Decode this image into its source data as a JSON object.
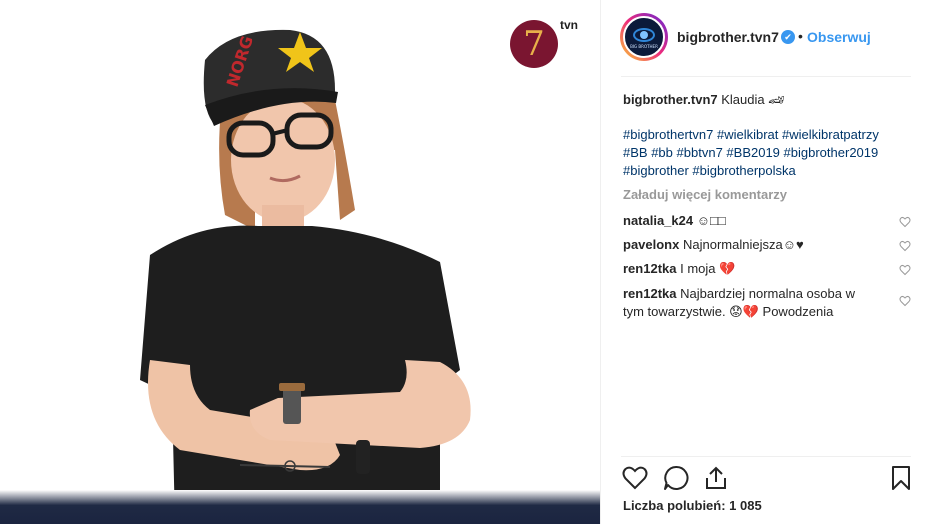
{
  "photo": {
    "channel_number": "7",
    "channel_name": "tvn",
    "cap_text": "NORG"
  },
  "header": {
    "username": "bigbrother.tvn7",
    "verified_mark": "✔",
    "separator": "•",
    "follow_label": "Obserwuj",
    "avatar_text": "BIG BROTHER"
  },
  "caption": {
    "username": "bigbrother.tvn7",
    "text": "Klaudia 🏎",
    "hashtags": [
      "#bigbrothertvn7",
      "#wielkibrat",
      "#wielkibratpatrzy",
      "#BB",
      "#bb",
      "#bbtvn7",
      "#BB2019",
      "#bigbrother2019",
      "#bigbrother",
      "#bigbrotherpolska"
    ]
  },
  "load_more_label": "Załaduj więcej komentarzy",
  "comments": [
    {
      "user": "natalia_k24",
      "text": "☺□□"
    },
    {
      "user": "pavelonx",
      "text": "Najnormalniejsza☺♥"
    },
    {
      "user": "ren12tka",
      "text": "I moja 💔"
    },
    {
      "user": "ren12tka",
      "text": "Najbardziej normalna osoba w tym towarzystwie. 😟💔 Powodzenia"
    }
  ],
  "actions": {
    "like_icon": "heart-icon",
    "comment_icon": "comment-icon",
    "share_icon": "share-icon",
    "save_icon": "bookmark-icon"
  },
  "likes_label": "Liczba polubień: 1 085",
  "colors": {
    "link_blue": "#3897f0",
    "hashtag": "#003569",
    "muted": "#999999",
    "tvn_circle": "#7a1530"
  }
}
